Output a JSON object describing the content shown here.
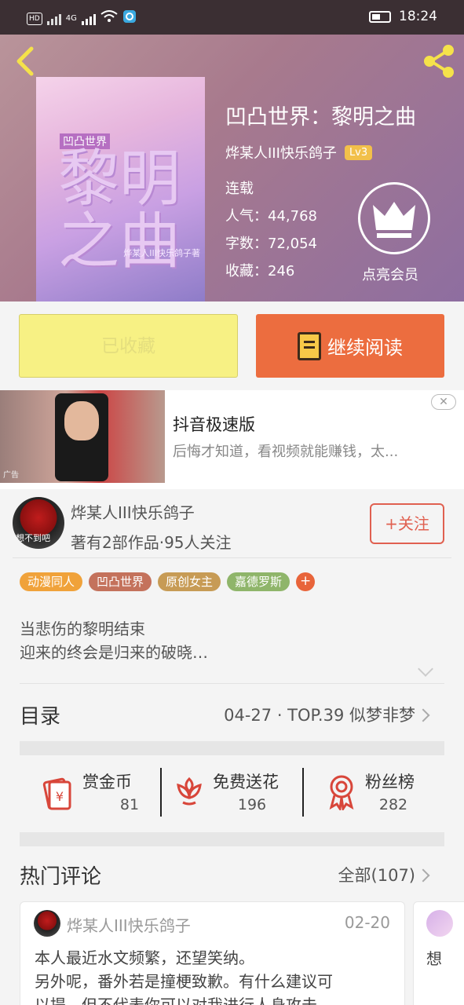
{
  "status_bar": {
    "network_chip": "HD",
    "network_type": "4G",
    "time": "18:24"
  },
  "book": {
    "cover_series": "凹凸世界",
    "cover_title": "黎明之曲",
    "cover_author": "烨某人III快乐鸽子著",
    "title": "凹凸世界：黎明之曲",
    "author": "烨某人III快乐鸽子",
    "level": "Lv3",
    "status": "连载",
    "popularity": "人气：44,768",
    "word_count": "字数：72,054",
    "favorites": "收藏：246",
    "vip_label": "点亮会员"
  },
  "buttons": {
    "collected": "已收藏",
    "continue_reading": "继续阅读"
  },
  "ad": {
    "tag": "广告",
    "title": "抖音极速版",
    "subtitle": "后悔才知道，看视频就能赚钱，太..."
  },
  "author_block": {
    "avatar_caption": "想不到吧",
    "name": "烨某人III快乐鸽子",
    "meta": "著有2部作品·95人关注",
    "follow": "+关注"
  },
  "tags": [
    {
      "label": "动漫同人",
      "color": "#f0a23a"
    },
    {
      "label": "凹凸世界",
      "color": "#c4725c"
    },
    {
      "label": "原创女主",
      "color": "#c79b55"
    },
    {
      "label": "嘉德罗斯",
      "color": "#8fb56a"
    }
  ],
  "tag_more": "+",
  "intro": {
    "line1": "当悲伤的黎明结束",
    "line2": "迎来的终会是归来的破晓…"
  },
  "catalog": {
    "title": "目录",
    "latest": "04-27 · TOP.39 似梦非梦"
  },
  "actions": [
    {
      "label": "赏金币",
      "count": "81",
      "icon": "gold-coin-icon"
    },
    {
      "label": "免费送花",
      "count": "196",
      "icon": "flower-icon"
    },
    {
      "label": "粉丝榜",
      "count": "282",
      "icon": "medal-icon"
    }
  ],
  "comments": {
    "title": "热门评论",
    "all": "全部(107)",
    "items": [
      {
        "name": "烨某人III快乐鸽子",
        "date": "02-20",
        "line1": "本人最近水文频繁，还望笑纳。",
        "line2": "另外呢，番外若是撞梗致歉。有什么建议可",
        "line3": "以提，但不代表你可以对我进行人身攻击"
      },
      {
        "text": "想"
      }
    ]
  },
  "colors": {
    "accent_orange": "#ec6d3f",
    "collected_yellow": "#f7f184",
    "follow_red": "#e06050"
  }
}
